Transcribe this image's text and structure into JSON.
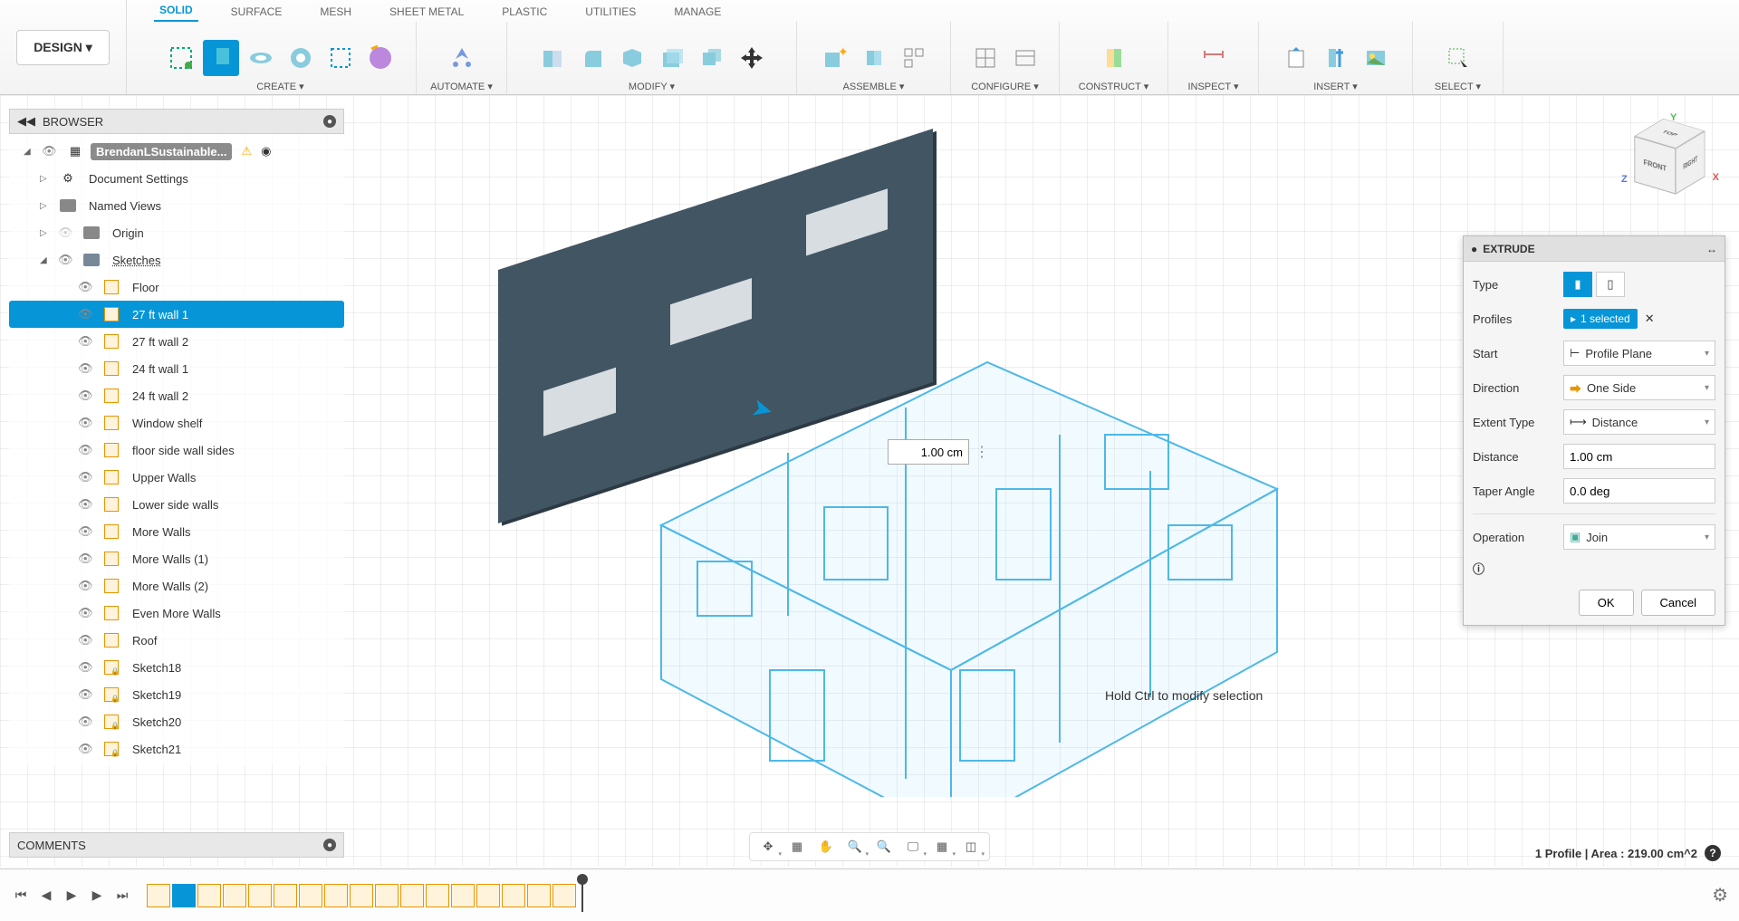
{
  "workspace_button": "DESIGN",
  "tabs": [
    "SOLID",
    "SURFACE",
    "MESH",
    "SHEET METAL",
    "PLASTIC",
    "UTILITIES",
    "MANAGE"
  ],
  "active_tab": "SOLID",
  "tool_groups": {
    "create": "CREATE",
    "automate": "AUTOMATE",
    "modify": "MODIFY",
    "assemble": "ASSEMBLE",
    "configure": "CONFIGURE",
    "construct": "CONSTRUCT",
    "inspect": "INSPECT",
    "insert": "INSERT",
    "select": "SELECT"
  },
  "browser": {
    "title": "BROWSER",
    "doc_title": "BrendanLSustainable...",
    "items": {
      "doc_settings": "Document Settings",
      "named_views": "Named Views",
      "origin": "Origin",
      "sketches": "Sketches"
    },
    "sketches": [
      {
        "label": "Floor",
        "selected": false,
        "locked": false
      },
      {
        "label": "27 ft wall 1",
        "selected": true,
        "locked": false
      },
      {
        "label": "27 ft wall 2",
        "selected": false,
        "locked": false
      },
      {
        "label": "24 ft wall 1",
        "selected": false,
        "locked": false
      },
      {
        "label": "24 ft wall 2",
        "selected": false,
        "locked": false
      },
      {
        "label": "Window shelf",
        "selected": false,
        "locked": false
      },
      {
        "label": "floor side wall sides",
        "selected": false,
        "locked": false
      },
      {
        "label": "Upper Walls",
        "selected": false,
        "locked": false
      },
      {
        "label": "Lower side walls",
        "selected": false,
        "locked": false
      },
      {
        "label": "More Walls",
        "selected": false,
        "locked": false
      },
      {
        "label": "More Walls (1)",
        "selected": false,
        "locked": false
      },
      {
        "label": "More Walls (2)",
        "selected": false,
        "locked": false
      },
      {
        "label": "Even More Walls",
        "selected": false,
        "locked": false
      },
      {
        "label": "Roof",
        "selected": false,
        "locked": false
      },
      {
        "label": "Sketch18",
        "selected": false,
        "locked": true
      },
      {
        "label": "Sketch19",
        "selected": false,
        "locked": true
      },
      {
        "label": "Sketch20",
        "selected": false,
        "locked": true
      },
      {
        "label": "Sketch21",
        "selected": false,
        "locked": true
      }
    ]
  },
  "comments_title": "COMMENTS",
  "dimension_value": "1.00 cm",
  "hint": "Hold Ctrl to modify selection",
  "viewcube": {
    "front": "FRONT",
    "right": "RIGHT",
    "top": "TOP",
    "x": "X",
    "y": "Y",
    "z": "Z"
  },
  "extrude": {
    "title": "EXTRUDE",
    "rows": {
      "type": "Type",
      "profiles": "Profiles",
      "profiles_value": "1 selected",
      "start": "Start",
      "start_value": "Profile Plane",
      "direction": "Direction",
      "direction_value": "One Side",
      "extent": "Extent Type",
      "extent_value": "Distance",
      "distance": "Distance",
      "distance_value": "1.00 cm",
      "taper": "Taper Angle",
      "taper_value": "0.0 deg",
      "operation": "Operation",
      "operation_value": "Join"
    },
    "ok": "OK",
    "cancel": "Cancel"
  },
  "status": "1 Profile | Area : 219.00 cm^2",
  "timeline_count": 17,
  "timeline_active_index": 1
}
